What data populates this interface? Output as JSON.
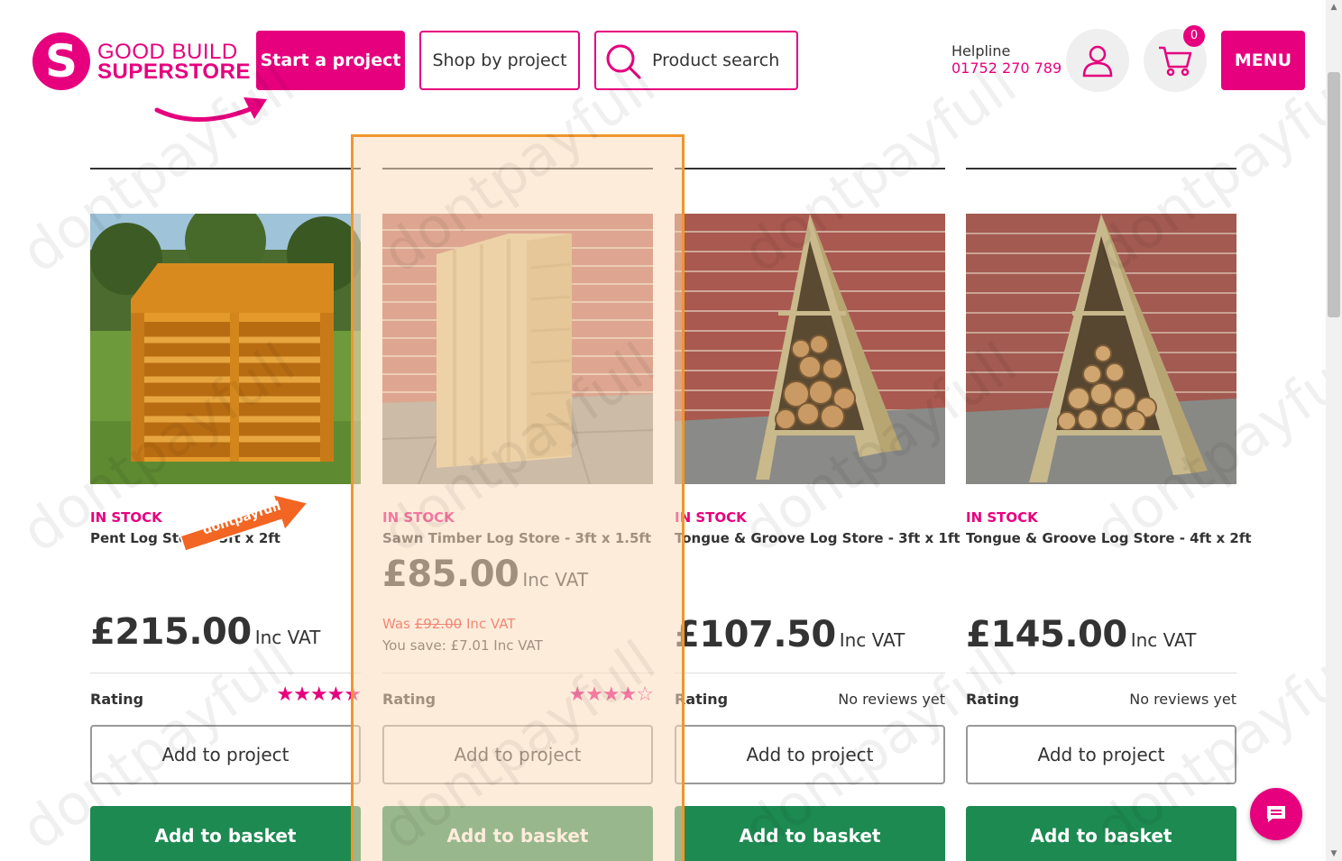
{
  "brand": {
    "logo_letter": "S",
    "line1": "GOOD BUILD",
    "line2": "SUPERSTORE",
    "color": "#e6007e"
  },
  "nav": {
    "start_project": "Start a project",
    "shop_by_project": "Shop by project",
    "product_search": "Product search",
    "menu": "MENU"
  },
  "helpline": {
    "label": "Helpline",
    "number": "01752 270 789"
  },
  "cart": {
    "count": "0"
  },
  "labels": {
    "rating": "Rating",
    "add_to_project": "Add to project",
    "add_to_basket": "Add to basket",
    "inc_vat": "Inc VAT",
    "no_reviews": "No reviews yet"
  },
  "products": [
    {
      "stock": "IN STOCK",
      "title": "Pent Log Store - 5ft x 2ft",
      "price": "£215.00",
      "stars": "★★★★★",
      "rating_stars": 5
    },
    {
      "stock": "IN STOCK",
      "title": "Sawn Timber Log Store - 3ft x 1.5ft",
      "price": "£85.00",
      "was_prefix": "Was",
      "was_price": "£92.00",
      "was_suffix": "Inc VAT",
      "you_save": "You save: £7.01 Inc VAT",
      "stars": "★★★★☆",
      "rating_stars": 4.5
    },
    {
      "stock": "IN STOCK",
      "title": "Tongue & Groove Log Store - 3ft x 1ft",
      "price": "£107.50",
      "reviews": "No reviews yet"
    },
    {
      "stock": "IN STOCK",
      "title": "Tongue & Groove Log Store - 4ft x 2ft",
      "price": "£145.00",
      "reviews": "No reviews yet"
    }
  ],
  "overlay": {
    "tag_text": "dontpayfull",
    "watermark": "dontpayfull",
    "highlight_color": "#f0962e"
  },
  "colors": {
    "accent": "#e6007e",
    "basket_green": "#1d8a52",
    "was_red": "#e32119"
  }
}
